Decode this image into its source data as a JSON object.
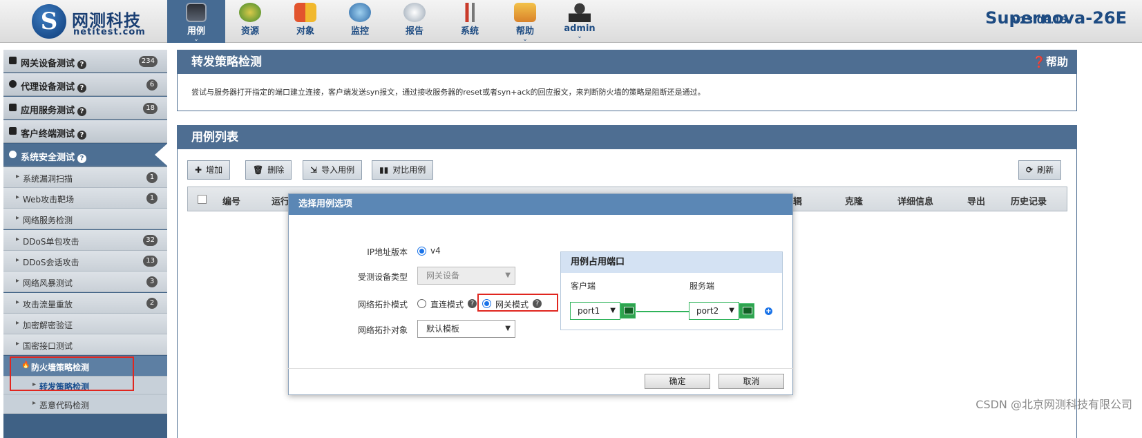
{
  "header": {
    "logo_cn": "网测科技",
    "logo_en": "netitest.com",
    "version": "V23.06.15",
    "product": "Supernova-26E",
    "nav": [
      {
        "label": "用例",
        "icon": "monitor-icon",
        "active": true,
        "chevron": "⌄"
      },
      {
        "label": "资源",
        "icon": "disk-icon",
        "active": false
      },
      {
        "label": "对象",
        "icon": "blocks-icon",
        "active": false
      },
      {
        "label": "监控",
        "icon": "magnifier-icon",
        "active": false
      },
      {
        "label": "报告",
        "icon": "satellite-icon",
        "active": false
      },
      {
        "label": "系统",
        "icon": "tools-icon",
        "active": false
      },
      {
        "label": "帮助",
        "icon": "help-icon",
        "active": false,
        "chevron": "⌄"
      },
      {
        "label": "admin",
        "icon": "user-icon",
        "active": false,
        "chevron": "⌄"
      }
    ]
  },
  "sidebar": {
    "main": [
      {
        "label": "网关设备测试",
        "badge": "234"
      },
      {
        "label": "代理设备测试",
        "badge": "6"
      },
      {
        "label": "应用服务测试",
        "badge": "18"
      },
      {
        "label": "客户终端测试",
        "badge": ""
      },
      {
        "label": "系统安全测试",
        "badge": "",
        "active": true
      }
    ],
    "sub": [
      {
        "label": "系统漏洞扫描",
        "badge": "1"
      },
      {
        "label": "Web攻击靶场",
        "badge": "1"
      },
      {
        "label": "网络服务检测",
        "badge": ""
      },
      {
        "label": "DDoS单包攻击",
        "badge": "32"
      },
      {
        "label": "DDoS会话攻击",
        "badge": "13"
      },
      {
        "label": "网络风暴测试",
        "badge": "3"
      },
      {
        "label": "攻击流量重放",
        "badge": "2"
      },
      {
        "label": "加密解密验证",
        "badge": ""
      },
      {
        "label": "国密接口测试",
        "badge": ""
      },
      {
        "label": "防火墙策略检测",
        "badge": "",
        "highlight": true
      }
    ],
    "sub2": [
      {
        "label": "转发策略检测",
        "active": true
      },
      {
        "label": "恶意代码检测",
        "active": false
      }
    ],
    "help_glyph": "?"
  },
  "info_panel": {
    "title": "转发策略检测",
    "help": "❓帮助",
    "description": "尝试与服务器打开指定的端口建立连接，客户端发送syn报文，通过接收服务器的reset或者syn+ack的回应报文，来判断防火墙的策略是阻断还是通过。"
  },
  "list_panel": {
    "title": "用例列表",
    "buttons": {
      "add": "增加",
      "delete": "删除",
      "import": "导入用例",
      "compare": "对比用例",
      "refresh": "刷新"
    },
    "columns": [
      "编号",
      "运行",
      "辑",
      "克隆",
      "详细信息",
      "导出",
      "历史记录"
    ]
  },
  "modal": {
    "title": "选择用例选项",
    "ip_version_label": "IP地址版本",
    "ip_version_value": "v4",
    "device_type_label": "受测设备类型",
    "device_type_value": "网关设备",
    "topology_label": "网络拓扑模式",
    "topology_options": [
      "直连模式",
      "网关模式"
    ],
    "topology_selected": "网关模式",
    "topology_object_label": "网络拓扑对象",
    "topology_object_value": "默认模板",
    "ports": {
      "title": "用例占用端口",
      "client_label": "客户端",
      "server_label": "服务端",
      "client_port": "port1",
      "server_port": "port2"
    },
    "ok": "确定",
    "cancel": "取消"
  },
  "watermark": "CSDN @北京网测科技有限公司",
  "colors": {
    "accent": "#4e6e92",
    "highlight": "#e0261f",
    "port_green": "#2fb35a"
  }
}
